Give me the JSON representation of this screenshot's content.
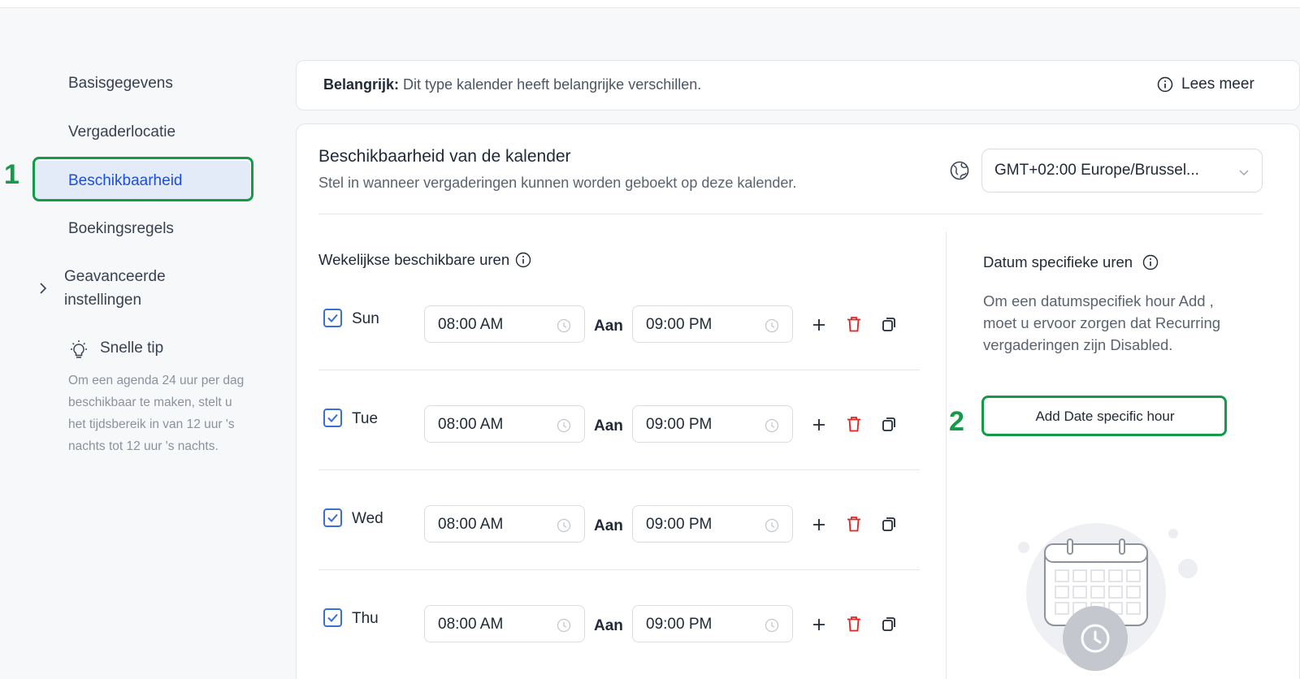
{
  "sidebar": {
    "items": [
      {
        "label": "Basisgegevens"
      },
      {
        "label": "Vergaderlocatie"
      },
      {
        "label": "Beschikbaarheid",
        "active": true
      },
      {
        "label": "Boekingsregels"
      }
    ],
    "advanced": {
      "line1": "Geavanceerde",
      "line2": "instellingen"
    },
    "tip": {
      "title": "Snelle tip",
      "text": "Om een agenda 24 uur per dag beschikbaar te maken, stelt u het tijdsbereik in van 12 uur 's nachts tot 12 uur 's nachts."
    }
  },
  "annotations": {
    "marker1": "1",
    "marker2": "2",
    "color": "#149a49"
  },
  "notice": {
    "bold": "Belangrijk:",
    "text": " Dit type kalender heeft belangrijke verschillen.",
    "link": "Lees meer"
  },
  "availability": {
    "title": "Beschikbaarheid van de kalender",
    "subtitle": "Stel in wanneer vergaderingen kunnen worden geboekt op deze kalender.",
    "timezone": "GMT+02:00 Europe/Brussel...",
    "weekly_title": "Wekelijkse beschikbare uren",
    "to_label": "Aan",
    "days": [
      {
        "day": "Sun",
        "checked": true,
        "start": "08:00 AM",
        "end": "09:00 PM"
      },
      {
        "day": "Tue",
        "checked": true,
        "start": "08:00 AM",
        "end": "09:00 PM"
      },
      {
        "day": "Wed",
        "checked": true,
        "start": "08:00 AM",
        "end": "09:00 PM"
      },
      {
        "day": "Thu",
        "checked": true,
        "start": "08:00 AM",
        "end": "09:00 PM"
      }
    ]
  },
  "date_specific": {
    "title": "Datum specifieke uren",
    "text": "Om een datumspecifiek hour Add , moet u ervoor zorgen dat Recurring vergaderingen zijn Disabled.",
    "button": "Add Date specific hour"
  },
  "colors": {
    "accent": "#1d4ed8",
    "delete": "#dc2626",
    "checkbox": "#3b6fd8"
  }
}
